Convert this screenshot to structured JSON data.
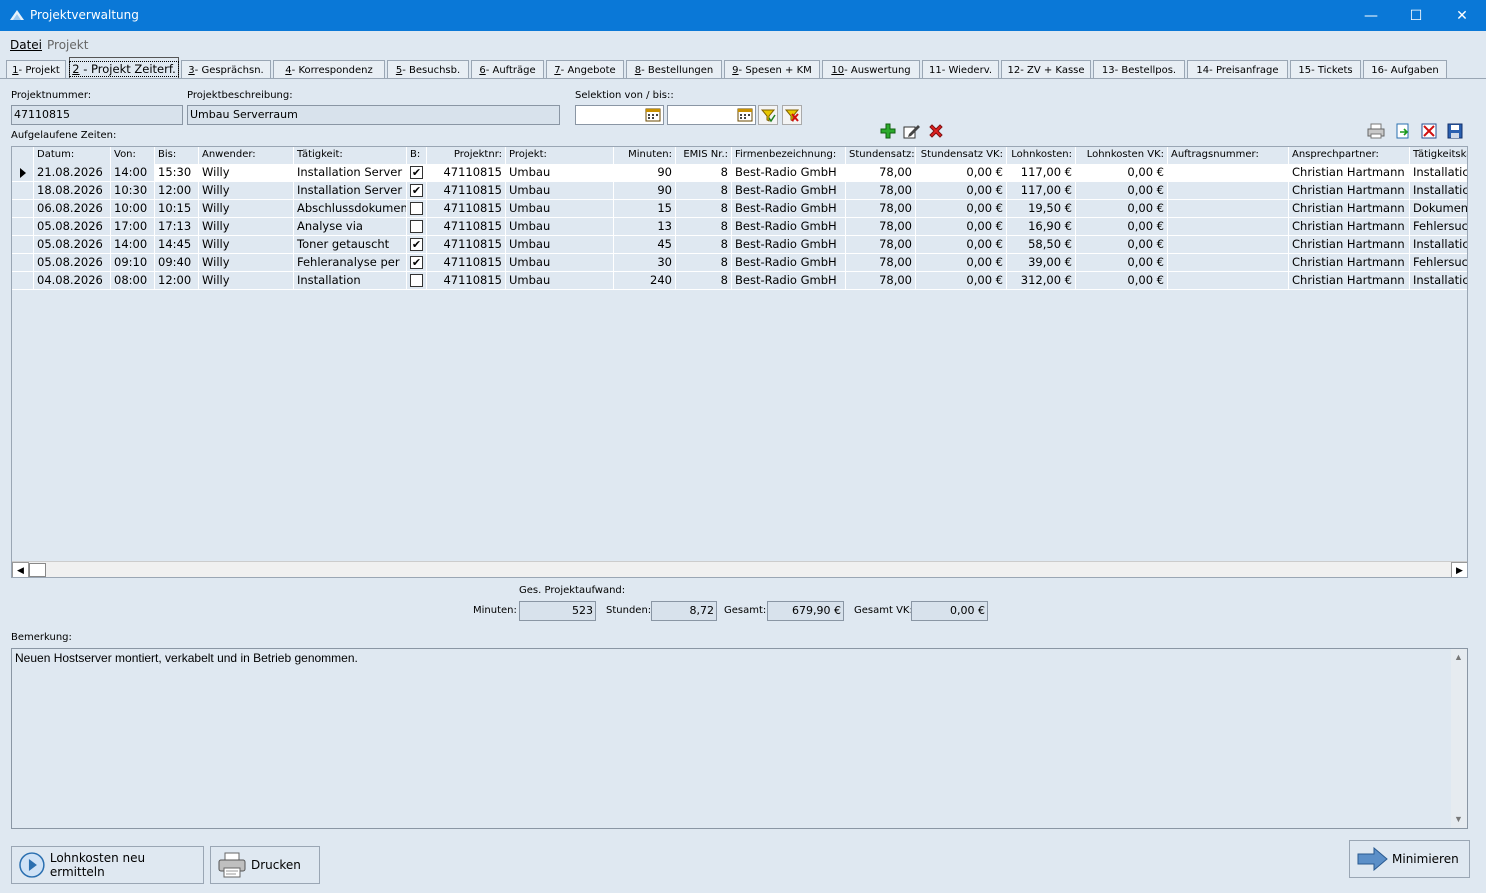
{
  "window": {
    "title": "Projektverwaltung",
    "minimize": "—",
    "maximize": "☐",
    "close": "✕"
  },
  "menu": {
    "datei": "Datei",
    "projekt": "Projekt"
  },
  "tabs": [
    {
      "num": "1",
      "label": " - Projekt"
    },
    {
      "num": "2",
      "label": " - Projekt Zeiterf."
    },
    {
      "num": "3",
      "label": " - Gesprächsn."
    },
    {
      "num": "4",
      "label": " - Korrespondenz"
    },
    {
      "num": "5",
      "label": " - Besuchsb."
    },
    {
      "num": "6",
      "label": " - Aufträge"
    },
    {
      "num": "7",
      "label": " - Angebote"
    },
    {
      "num": "8",
      "label": " - Bestellungen"
    },
    {
      "num": "9",
      "label": " - Spesen + KM"
    },
    {
      "num": "10",
      "label": " - Auswertung"
    },
    {
      "num": "11",
      "label": " - Wiederv."
    },
    {
      "num": "12",
      "label": " - ZV + Kasse"
    },
    {
      "num": "13",
      "label": " - Bestellpos."
    },
    {
      "num": "14",
      "label": " - Preisanfrage"
    },
    {
      "num": "15",
      "label": " - Tickets"
    },
    {
      "num": "16",
      "label": " - Aufgaben"
    }
  ],
  "form": {
    "projektnummer_label": "Projektnummer:",
    "projektnummer": "47110815",
    "projektbeschreibung_label": "Projektbeschreibung:",
    "projektbeschreibung": "Umbau Serverraum",
    "selektion_label": "Selektion von / bis::",
    "von": "",
    "bis": "",
    "zeiten_label": "Aufgelaufene Zeiten:"
  },
  "grid": {
    "columns": [
      "Datum:",
      "Von:",
      "Bis:",
      "Anwender:",
      "Tätigkeit:",
      "B:",
      "Projektnr:",
      "Projekt:",
      "Minuten:",
      "EMIS Nr.:",
      "Firmenbezeichnung:",
      "Stundensatz:",
      "Stundensatz VK:",
      "Lohnkosten:",
      "Lohnkosten VK:",
      "Auftragsnummer:",
      "Ansprechpartner:",
      "Tätigkeitska"
    ],
    "rows": [
      [
        "21.08.2026",
        "14:00",
        "15:30",
        "Willy",
        "Installation Server",
        true,
        "47110815",
        "Umbau",
        "90",
        "8",
        "Best-Radio GmbH",
        "78,00",
        "0,00 €",
        "117,00 €",
        "0,00 €",
        "",
        "Christian Hartmann",
        "Installatic"
      ],
      [
        "18.08.2026",
        "10:30",
        "12:00",
        "Willy",
        "Installation Server",
        true,
        "47110815",
        "Umbau",
        "90",
        "8",
        "Best-Radio GmbH",
        "78,00",
        "0,00 €",
        "117,00 €",
        "0,00 €",
        "",
        "Christian Hartmann",
        "Installatic"
      ],
      [
        "06.08.2026",
        "10:00",
        "10:15",
        "Willy",
        "Abschlussdokumen",
        false,
        "47110815",
        "Umbau",
        "15",
        "8",
        "Best-Radio GmbH",
        "78,00",
        "0,00 €",
        "19,50 €",
        "0,00 €",
        "",
        "Christian Hartmann",
        "Dokument"
      ],
      [
        "05.08.2026",
        "17:00",
        "17:13",
        "Willy",
        "Analyse via",
        false,
        "47110815",
        "Umbau",
        "13",
        "8",
        "Best-Radio GmbH",
        "78,00",
        "0,00 €",
        "16,90 €",
        "0,00 €",
        "",
        "Christian Hartmann",
        "Fehlersucl"
      ],
      [
        "05.08.2026",
        "14:00",
        "14:45",
        "Willy",
        "Toner getauscht",
        true,
        "47110815",
        "Umbau",
        "45",
        "8",
        "Best-Radio GmbH",
        "78,00",
        "0,00 €",
        "58,50 €",
        "0,00 €",
        "",
        "Christian Hartmann",
        "Installatic"
      ],
      [
        "05.08.2026",
        "09:10",
        "09:40",
        "Willy",
        "Fehleranalyse per",
        true,
        "47110815",
        "Umbau",
        "30",
        "8",
        "Best-Radio GmbH",
        "78,00",
        "0,00 €",
        "39,00 €",
        "0,00 €",
        "",
        "Christian Hartmann",
        "Fehlersucl"
      ],
      [
        "04.08.2026",
        "08:00",
        "12:00",
        "Willy",
        "Installation",
        false,
        "47110815",
        "Umbau",
        "240",
        "8",
        "Best-Radio GmbH",
        "78,00",
        "0,00 €",
        "312,00 €",
        "0,00 €",
        "",
        "Christian Hartmann",
        "Installatic"
      ]
    ]
  },
  "totals": {
    "heading": "Ges. Projektaufwand:",
    "minuten_label": "Minuten:",
    "minuten": "523",
    "stunden_label": "Stunden:",
    "stunden": "8,72",
    "gesamt_label": "Gesamt:",
    "gesamt": "679,90 €",
    "gesamt_vk_label": "Gesamt VK:",
    "gesamt_vk": "0,00 €"
  },
  "bemerkung": {
    "label": "Bemerkung:",
    "text": "Neuen Hostserver montiert, verkabelt und in Betrieb genommen."
  },
  "buttons": {
    "lohnkosten": "Lohnkosten neu ermitteln",
    "drucken": "Drucken",
    "minimieren": "Minimieren"
  },
  "colors": {
    "titlebar": "#0a78d7",
    "background": "#dfe8f1",
    "selected_row": "#ffffff"
  }
}
